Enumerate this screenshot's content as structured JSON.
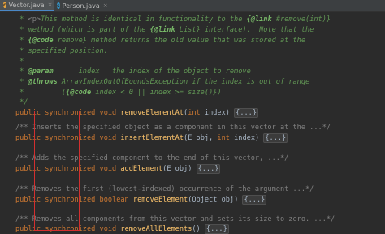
{
  "tabs": [
    {
      "label": "Vector.java",
      "icon": "class-icon",
      "color": "#e8a33d",
      "active": true
    },
    {
      "label": "Person.java",
      "icon": "class-icon",
      "color": "#3592c4",
      "active": false
    }
  ],
  "close_glyph": "×",
  "javadoc": {
    "l1_star": " * ",
    "l1_p": "<p>",
    "l1_a": "This method is identical in functionality to the ",
    "l1_link": "{@link",
    "l1_b": " #remove(int)}",
    "l2": " * method (which is part of the ",
    "l2_link": "{@link",
    "l2_b": " List} interface).  Note that the",
    "l3_star": " * ",
    "l3_code": "{@code",
    "l3_b": " remove} method returns the old value that was stored at the",
    "l4": " * specified position.",
    "l5": " *",
    "l6_star": " * ",
    "l6_param": "@param",
    "l6_b": "      index   the index of the object to remove",
    "l7_star": " * ",
    "l7_throws": "@throws",
    "l7_b": " ArrayIndexOutOfBoundsException if the index is out of range",
    "l8_a": " *         (",
    "l8_code": "{@code",
    "l8_b": " index < 0 || index >= size()})",
    "l9": " */"
  },
  "methods": [
    {
      "comment": "/** Inserts the specified object as a component in this vector at the ...*/",
      "modifier": "public",
      "sync": "synchronized",
      "ret": "void",
      "name": "removeElementAt",
      "params_a": "(",
      "params_kw": "int",
      "params_b": " index) ",
      "fold": "{...}"
    },
    {
      "comment": "",
      "modifier": "public",
      "sync": "synchronized",
      "ret": "void",
      "name": "insertElementAt",
      "params_a": "(E obj, ",
      "params_kw": "int",
      "params_b": " index) ",
      "fold": "{...}"
    },
    {
      "comment": "/** Adds the specified component to the end of this vector, ...*/",
      "modifier": "public",
      "sync": "synchronized",
      "ret": "void",
      "name": "addElement",
      "params_a": "(E obj) ",
      "params_kw": "",
      "params_b": "",
      "fold": "{...}"
    },
    {
      "comment": "/** Removes the first (lowest-indexed) occurrence of the argument ...*/",
      "modifier": "public",
      "sync": "synchronized",
      "ret": "boolean",
      "name": "removeElement",
      "params_a": "(Object obj) ",
      "params_kw": "",
      "params_b": "",
      "fold": "{...}"
    },
    {
      "comment": "/** Removes all components from this vector and sets its size to zero. ...*/",
      "modifier": "public",
      "sync": "synchronized",
      "ret": "void",
      "name": "removeAllElements",
      "params_a": "() ",
      "params_kw": "",
      "params_b": "",
      "fold": "{...}"
    }
  ],
  "colors": {
    "background": "#2b2b2b",
    "keyword": "#cc7832",
    "method": "#ffc66d",
    "doc_comment": "#629755",
    "comment": "#808080",
    "highlight_box": "#d32f2f"
  }
}
